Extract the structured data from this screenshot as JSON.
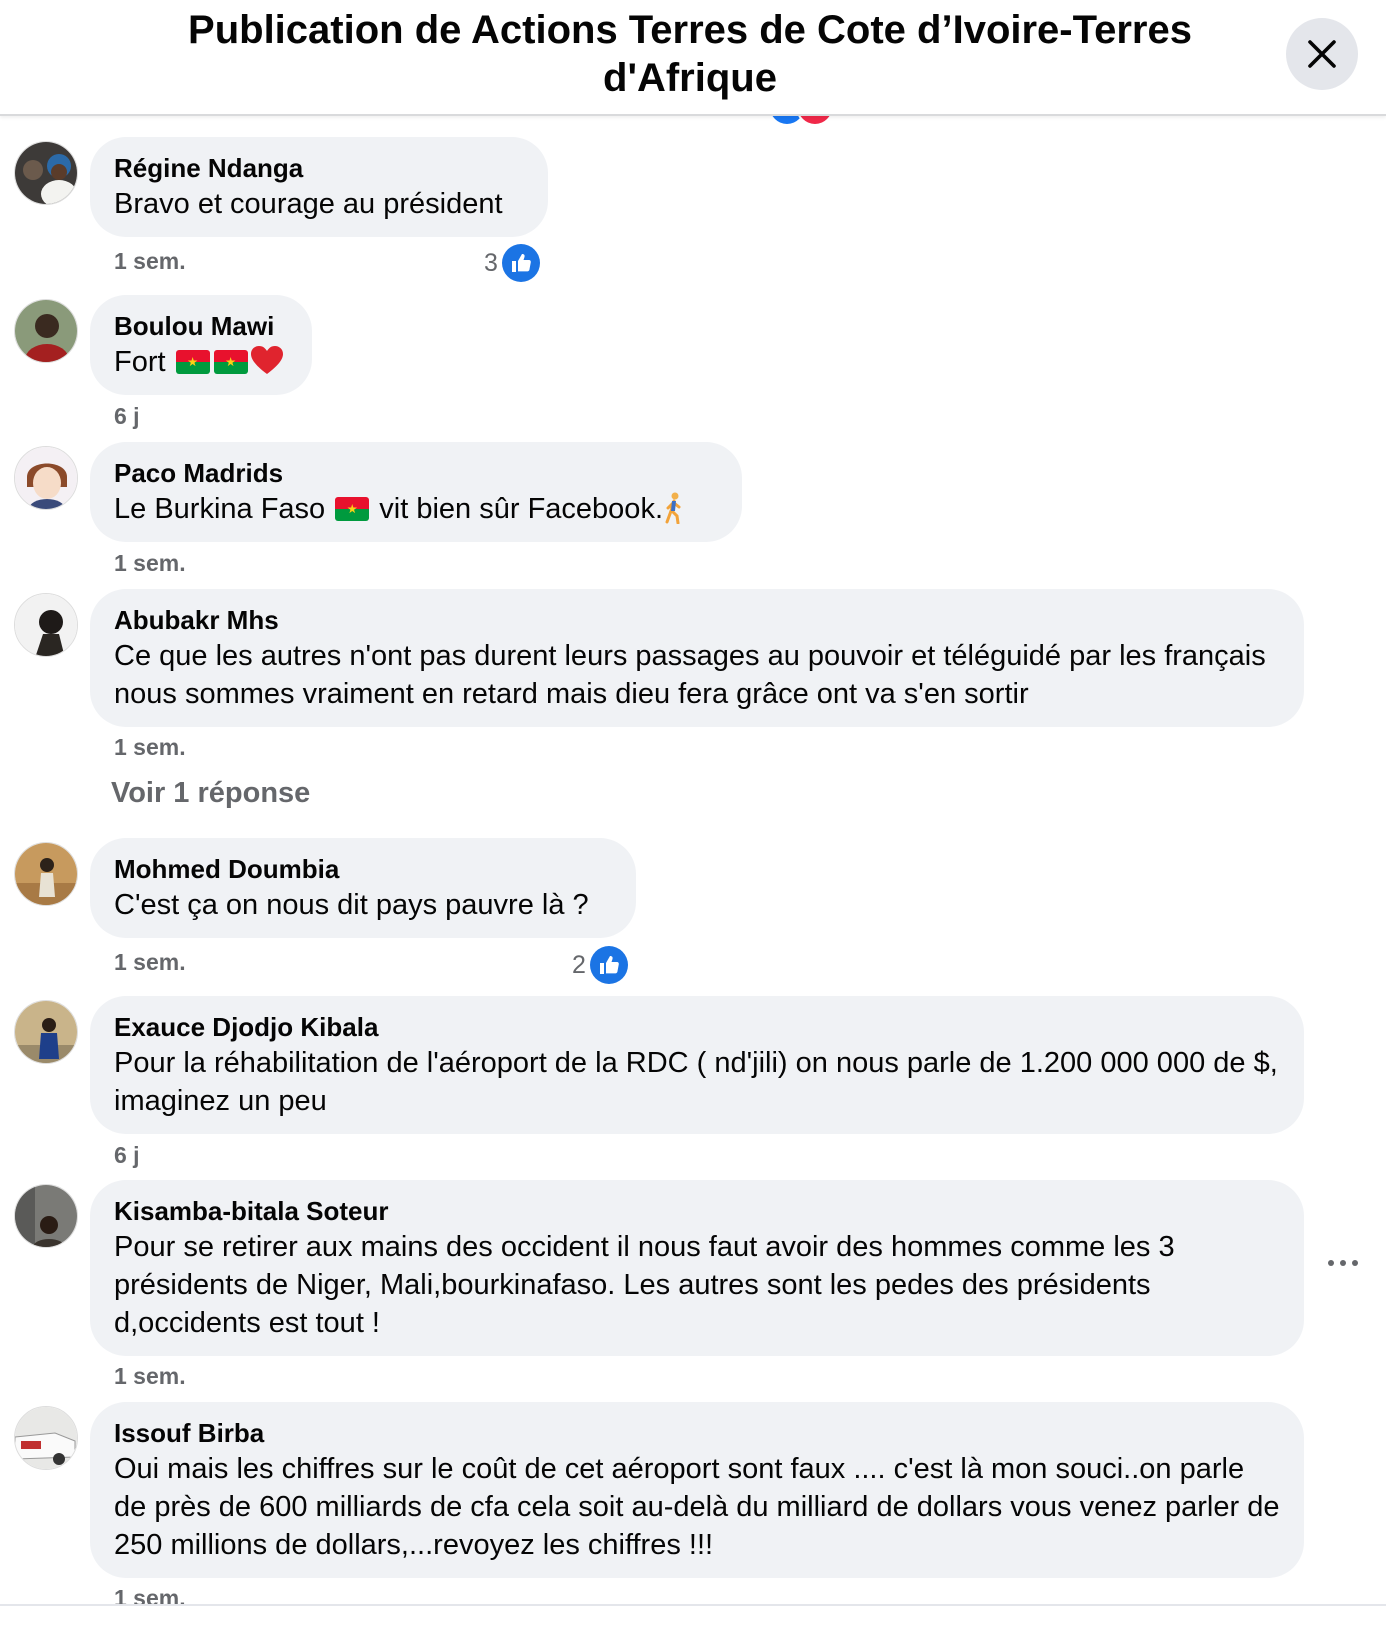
{
  "header": {
    "title": "Publication de Actions Terres de Cote d’Ivoire-Terres d'Afrique",
    "close_icon": "close-icon"
  },
  "comments": [
    {
      "author": "Régine Ndanga",
      "text": "Bravo et courage au président",
      "time": "1 sem.",
      "likes": "3"
    },
    {
      "author": "Boulou Mawi",
      "text": "Fort",
      "time": "6 j",
      "emoji": [
        "burkina-faso-flag",
        "burkina-faso-flag",
        "red-heart"
      ]
    },
    {
      "author": "Paco Madrids",
      "text_before": "Le Burkina Faso",
      "text_after": "vit bien sûr Facebook.",
      "time": "1 sem.",
      "emoji": [
        "burkina-faso-flag",
        "person-walking"
      ]
    },
    {
      "author": "Abubakr Mhs",
      "text": "Ce que les autres n'ont pas durent leurs passages au pouvoir et téléguidé par les français nous sommes vraiment en retard mais dieu fera grâce ont va s'en sortir",
      "time": "1 sem.",
      "reply_link": "Voir 1 réponse"
    },
    {
      "author": "Mohmed Doumbia",
      "text": "C'est ça on nous dit pays pauvre là ?",
      "time": "1 sem.",
      "likes": "2"
    },
    {
      "author": "Exauce Djodjo Kibala",
      "text": "Pour la réhabilitation de l'aéroport de la RDC ( nd'jili) on nous parle de 1.200 000 000 de $, imaginez un peu",
      "time": "6 j"
    },
    {
      "author": "Kisamba-bitala Soteur",
      "text": "Pour se retirer aux mains des occident il nous faut avoir des hommes comme les 3 présidents de Niger, Mali,bourkinafaso. Les autres sont les pedes des présidents d,occidents est tout !",
      "time": "1 sem."
    },
    {
      "author": "Issouf Birba",
      "text": "Oui mais les chiffres sur le coût de cet aéroport sont faux .... c'est là mon souci..on parle de près de 600 milliards de cfa cela soit au-delà du milliard de dollars vous venez parler de 250 millions de dollars,...revoyez les chiffres !!!",
      "time": "1 sem."
    }
  ],
  "colors": {
    "bubble": "#f0f2f5",
    "meta_text": "#65676b",
    "like_blue": "#1b74e4"
  }
}
